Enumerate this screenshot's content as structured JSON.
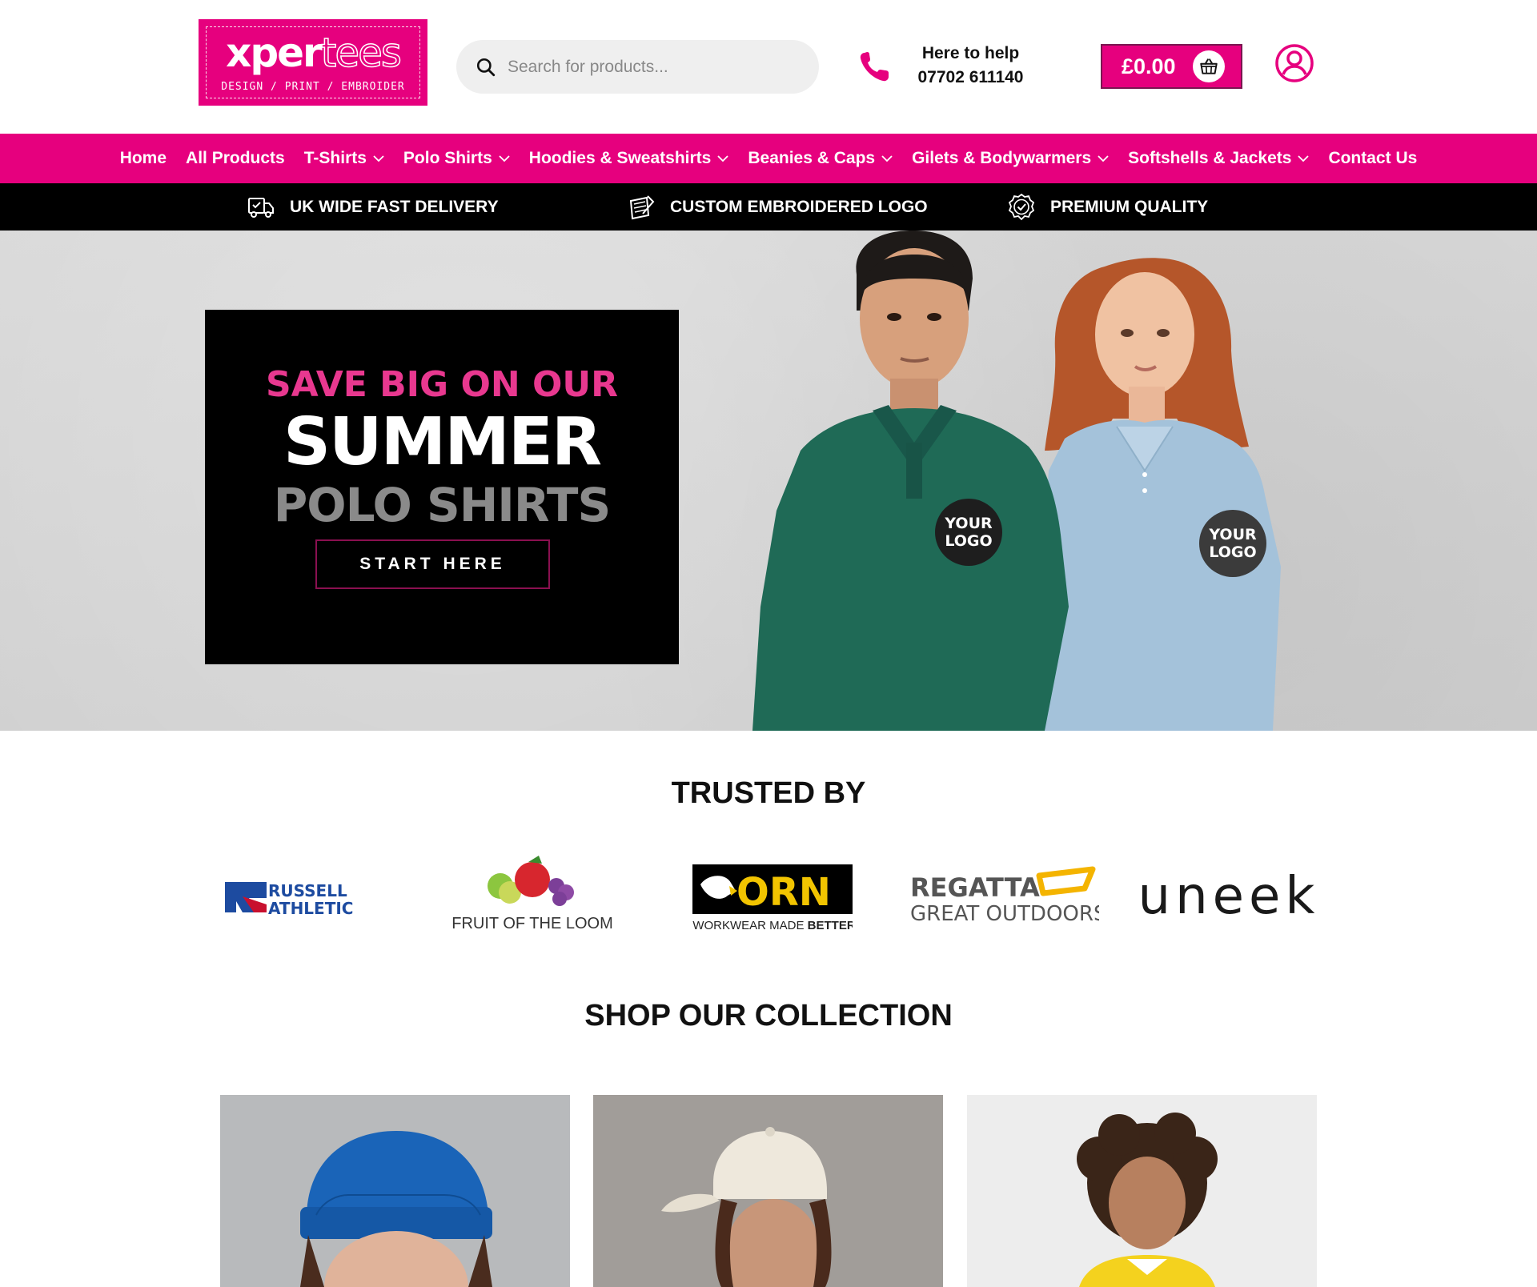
{
  "header": {
    "logo": {
      "word_bold": "xper",
      "word_outline": "tees",
      "tagline": "DESIGN / PRINT / EMBROIDER"
    },
    "search": {
      "placeholder": "Search for products..."
    },
    "help": {
      "title": "Here to help",
      "phone": "07702 611140",
      "icon": "phone-icon"
    },
    "cart": {
      "amount": "£0.00",
      "icon": "basket-icon"
    },
    "account": {
      "icon": "user-account-icon"
    }
  },
  "nav": {
    "items": [
      {
        "label": "Home",
        "dropdown": false
      },
      {
        "label": "All Products",
        "dropdown": false
      },
      {
        "label": "T-Shirts",
        "dropdown": true
      },
      {
        "label": "Polo Shirts",
        "dropdown": true
      },
      {
        "label": "Hoodies & Sweatshirts",
        "dropdown": true
      },
      {
        "label": "Beanies & Caps",
        "dropdown": true
      },
      {
        "label": "Gilets & Bodywarmers",
        "dropdown": true
      },
      {
        "label": "Softshells & Jackets",
        "dropdown": true
      },
      {
        "label": "Contact Us",
        "dropdown": false
      }
    ]
  },
  "features": {
    "items": [
      {
        "label": "UK WIDE FAST DELIVERY",
        "icon": "delivery-truck-icon"
      },
      {
        "label": "CUSTOM EMBROIDERED LOGO",
        "icon": "embroidery-icon"
      },
      {
        "label": "PREMIUM QUALITY",
        "icon": "quality-badge-icon"
      }
    ]
  },
  "hero": {
    "line1": "SAVE BIG ON OUR",
    "line2": "SUMMER",
    "line3": "POLO SHIRTS",
    "button": "START HERE",
    "badge_text_1": "YOUR",
    "badge_text_2": "LOGO"
  },
  "trusted": {
    "title": "TRUSTED BY",
    "brands": [
      {
        "name": "RUSSELL ATHLETIC"
      },
      {
        "name": "FRUIT OF THE LOOM"
      },
      {
        "name": "ORN",
        "tagline_a": "WORKWEAR MADE ",
        "tagline_b": "BETTER"
      },
      {
        "name": "REGATTA",
        "tagline": "GREAT OUTDOORS"
      },
      {
        "name": "uneek"
      }
    ]
  },
  "collection": {
    "title": "SHOP OUR COLLECTION"
  },
  "colors": {
    "brand_pink": "#e6007e",
    "black": "#000000"
  }
}
